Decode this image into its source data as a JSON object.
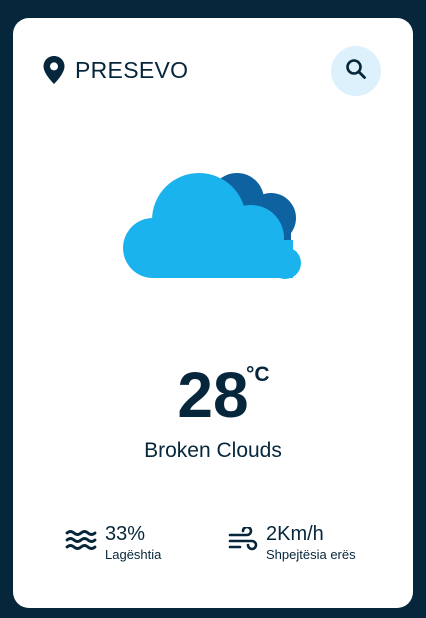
{
  "header": {
    "city": "PRESEVO",
    "icons": {
      "location": "location-pin-icon",
      "search": "search-icon"
    }
  },
  "weather": {
    "icon": "broken-clouds-icon",
    "temperature": "28",
    "unit": "°C",
    "condition": "Broken Clouds"
  },
  "stats": {
    "humidity": {
      "icon": "humidity-waves-icon",
      "value": "33%",
      "label": "Lagështia"
    },
    "wind": {
      "icon": "wind-icon",
      "value": "2Km/h",
      "label": "Shpejtësia erës"
    }
  },
  "colors": {
    "background": "#06263b",
    "card": "#ffffff",
    "text": "#06263b",
    "search_bg": "#dcf1fb",
    "cloud_front": "#1ab3ee",
    "cloud_back": "#0f62a0"
  }
}
